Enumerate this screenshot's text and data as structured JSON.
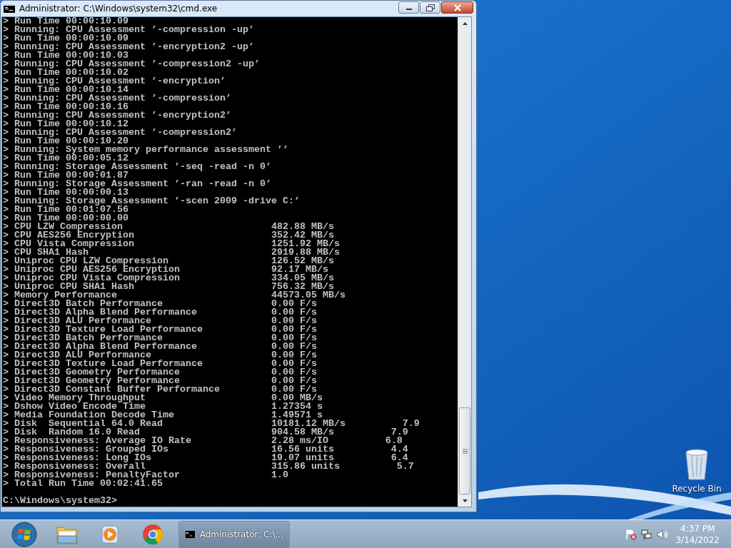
{
  "window": {
    "title": "Administrator: C:\\Windows\\system32\\cmd.exe",
    "console": {
      "lines": [
        {
          "kind": "text",
          "text": "> Run Time 00:00:10.09"
        },
        {
          "kind": "text",
          "text": "> Running: CPU Assessment ’-compression -up’"
        },
        {
          "kind": "text",
          "text": "> Run Time 00:00:10.09"
        },
        {
          "kind": "text",
          "text": "> Running: CPU Assessment ’-encryption2 -up’"
        },
        {
          "kind": "text",
          "text": "> Run Time 00:00:10.03"
        },
        {
          "kind": "text",
          "text": "> Running: CPU Assessment ’-compression2 -up’"
        },
        {
          "kind": "text",
          "text": "> Run Time 00:00:10.02"
        },
        {
          "kind": "text",
          "text": "> Running: CPU Assessment ’-encryption’"
        },
        {
          "kind": "text",
          "text": "> Run Time 00:00:10.14"
        },
        {
          "kind": "text",
          "text": "> Running: CPU Assessment ’-compression’"
        },
        {
          "kind": "text",
          "text": "> Run Time 00:00:10.16"
        },
        {
          "kind": "text",
          "text": "> Running: CPU Assessment ’-encryption2’"
        },
        {
          "kind": "text",
          "text": "> Run Time 00:00:10.12"
        },
        {
          "kind": "text",
          "text": "> Running: CPU Assessment ’-compression2’"
        },
        {
          "kind": "text",
          "text": "> Run Time 00:00:10.20"
        },
        {
          "kind": "text",
          "text": "> Running: System memory performance assessment ’’"
        },
        {
          "kind": "text",
          "text": "> Run Time 00:00:05.12"
        },
        {
          "kind": "text",
          "text": "> Running: Storage Assessment ’-seq -read -n 0’"
        },
        {
          "kind": "text",
          "text": "> Run Time 00:00:01.87"
        },
        {
          "kind": "text",
          "text": "> Running: Storage Assessment ’-ran -read -n 0’"
        },
        {
          "kind": "text",
          "text": "> Run Time 00:00:00.13"
        },
        {
          "kind": "text",
          "text": "> Running: Storage Assessment ’-scen 2009 -drive C:’"
        },
        {
          "kind": "text",
          "text": "> Run Time 00:01:07.56"
        },
        {
          "kind": "text",
          "text": "> Run Time 00:00:00.00"
        },
        {
          "kind": "result",
          "label": "> CPU LZW Compression",
          "value": "482.88 MB/s"
        },
        {
          "kind": "result",
          "label": "> CPU AES256 Encryption",
          "value": "352.42 MB/s"
        },
        {
          "kind": "result",
          "label": "> CPU Vista Compression",
          "value": "1251.92 MB/s"
        },
        {
          "kind": "result",
          "label": "> CPU SHA1 Hash",
          "value": "2919.88 MB/s"
        },
        {
          "kind": "result",
          "label": "> Uniproc CPU LZW Compression",
          "value": "126.52 MB/s"
        },
        {
          "kind": "result",
          "label": "> Uniproc CPU AES256 Encryption",
          "value": "92.17 MB/s"
        },
        {
          "kind": "result",
          "label": "> Uniproc CPU Vista Compression",
          "value": "334.05 MB/s"
        },
        {
          "kind": "result",
          "label": "> Uniproc CPU SHA1 Hash",
          "value": "756.32 MB/s"
        },
        {
          "kind": "result",
          "label": "> Memory Performance",
          "value": "44573.05 MB/s"
        },
        {
          "kind": "result",
          "label": "> Direct3D Batch Performance",
          "value": "0.00 F/s"
        },
        {
          "kind": "result",
          "label": "> Direct3D Alpha Blend Performance",
          "value": "0.00 F/s"
        },
        {
          "kind": "result",
          "label": "> Direct3D ALU Performance",
          "value": "0.00 F/s"
        },
        {
          "kind": "result",
          "label": "> Direct3D Texture Load Performance",
          "value": "0.00 F/s"
        },
        {
          "kind": "result",
          "label": "> Direct3D Batch Performance",
          "value": "0.00 F/s"
        },
        {
          "kind": "result",
          "label": "> Direct3D Alpha Blend Performance",
          "value": "0.00 F/s"
        },
        {
          "kind": "result",
          "label": "> Direct3D ALU Performance",
          "value": "0.00 F/s"
        },
        {
          "kind": "result",
          "label": "> Direct3D Texture Load Performance",
          "value": "0.00 F/s"
        },
        {
          "kind": "result",
          "label": "> Direct3D Geometry Performance",
          "value": "0.00 F/s"
        },
        {
          "kind": "result",
          "label": "> Direct3D Geometry Performance",
          "value": "0.00 F/s"
        },
        {
          "kind": "result",
          "label": "> Direct3D Constant Buffer Performance",
          "value": "0.00 F/s"
        },
        {
          "kind": "result",
          "label": "> Video Memory Throughput",
          "value": "0.00 MB/s"
        },
        {
          "kind": "result",
          "label": "> Dshow Video Encode Time",
          "value": "1.27354 s"
        },
        {
          "kind": "result",
          "label": "> Media Foundation Decode Time",
          "value": "1.49571 s"
        },
        {
          "kind": "result",
          "label": "> Disk  Sequential 64.0 Read",
          "value": "10181.12 MB/s",
          "score": "7.9"
        },
        {
          "kind": "result",
          "label": "> Disk  Random 16.0 Read",
          "value": "904.58 MB/s",
          "score": "7.9"
        },
        {
          "kind": "result",
          "label": "> Responsiveness: Average IO Rate",
          "value": "2.28 ms/IO",
          "score": "6.8"
        },
        {
          "kind": "result",
          "label": "> Responsiveness: Grouped IOs",
          "value": "16.56 units",
          "score": "4.4"
        },
        {
          "kind": "result",
          "label": "> Responsiveness: Long IOs",
          "value": "19.07 units",
          "score": "6.4"
        },
        {
          "kind": "result",
          "label": "> Responsiveness: Overall",
          "value": "315.86 units",
          "score": "5.7"
        },
        {
          "kind": "result",
          "label": "> Responsiveness: PenaltyFactor",
          "value": "1.0"
        },
        {
          "kind": "text",
          "text": "> Total Run Time 00:02:41.65"
        }
      ],
      "prompt": "C:\\Windows\\system32>"
    }
  },
  "desktop_icons": [
    {
      "label": "Recycle Bin"
    }
  ],
  "taskbar": {
    "task_buttons": [
      {
        "label": "Administrator: C:\\...",
        "selected": true
      }
    ],
    "clock": {
      "time": "4:37 PM",
      "date": "3/14/2022"
    }
  }
}
